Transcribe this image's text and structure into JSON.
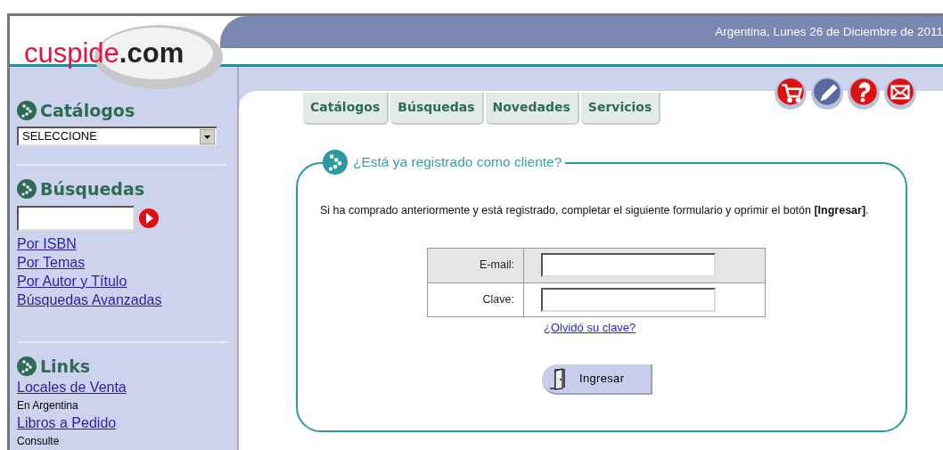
{
  "header": {
    "logo": {
      "name": "cuspide",
      "suffix": ".com"
    },
    "date": "Argentina, Lunes 26 de Diciembre de 2011"
  },
  "sidebar": {
    "sections": [
      {
        "kind": "select",
        "title": "Catálogos",
        "select_value": "SELECCIONE"
      },
      {
        "kind": "search",
        "title": "Búsquedas",
        "links": [
          "Por ISBN",
          "Por Temas",
          "Por Autor y Título",
          "Búsquedas Avanzadas"
        ]
      },
      {
        "kind": "links",
        "title": "Links",
        "items": [
          {
            "link": "Locales de Venta",
            "note": "En Argentina"
          },
          {
            "link": "Libros a Pedido",
            "note": "Consulte"
          }
        ]
      }
    ]
  },
  "tabs": [
    {
      "label": "Catálogos",
      "selected": false
    },
    {
      "label": "Búsquedas",
      "selected": false
    },
    {
      "label": "Novedades",
      "selected": false
    },
    {
      "label": "Servicios",
      "selected": false
    }
  ],
  "toolbar_icons": [
    {
      "kind": "cart",
      "color": "#e01010"
    },
    {
      "kind": "pencil",
      "color": "#5a6aa0"
    },
    {
      "kind": "help",
      "color": "#e01010"
    },
    {
      "kind": "mail",
      "color": "#e01010"
    }
  ],
  "login": {
    "title": "¿Está ya registrado como cliente?",
    "intro": "Si ha comprado anteriormente y está registrado, completar el siguiente formulario y oprimir el botón **[Ingresar]**.",
    "fields": [
      {
        "label": "E-mail:"
      },
      {
        "label": "Clave:"
      }
    ],
    "forgot_link": "¿Olvidó su clave?",
    "submit": "Ingresar"
  }
}
